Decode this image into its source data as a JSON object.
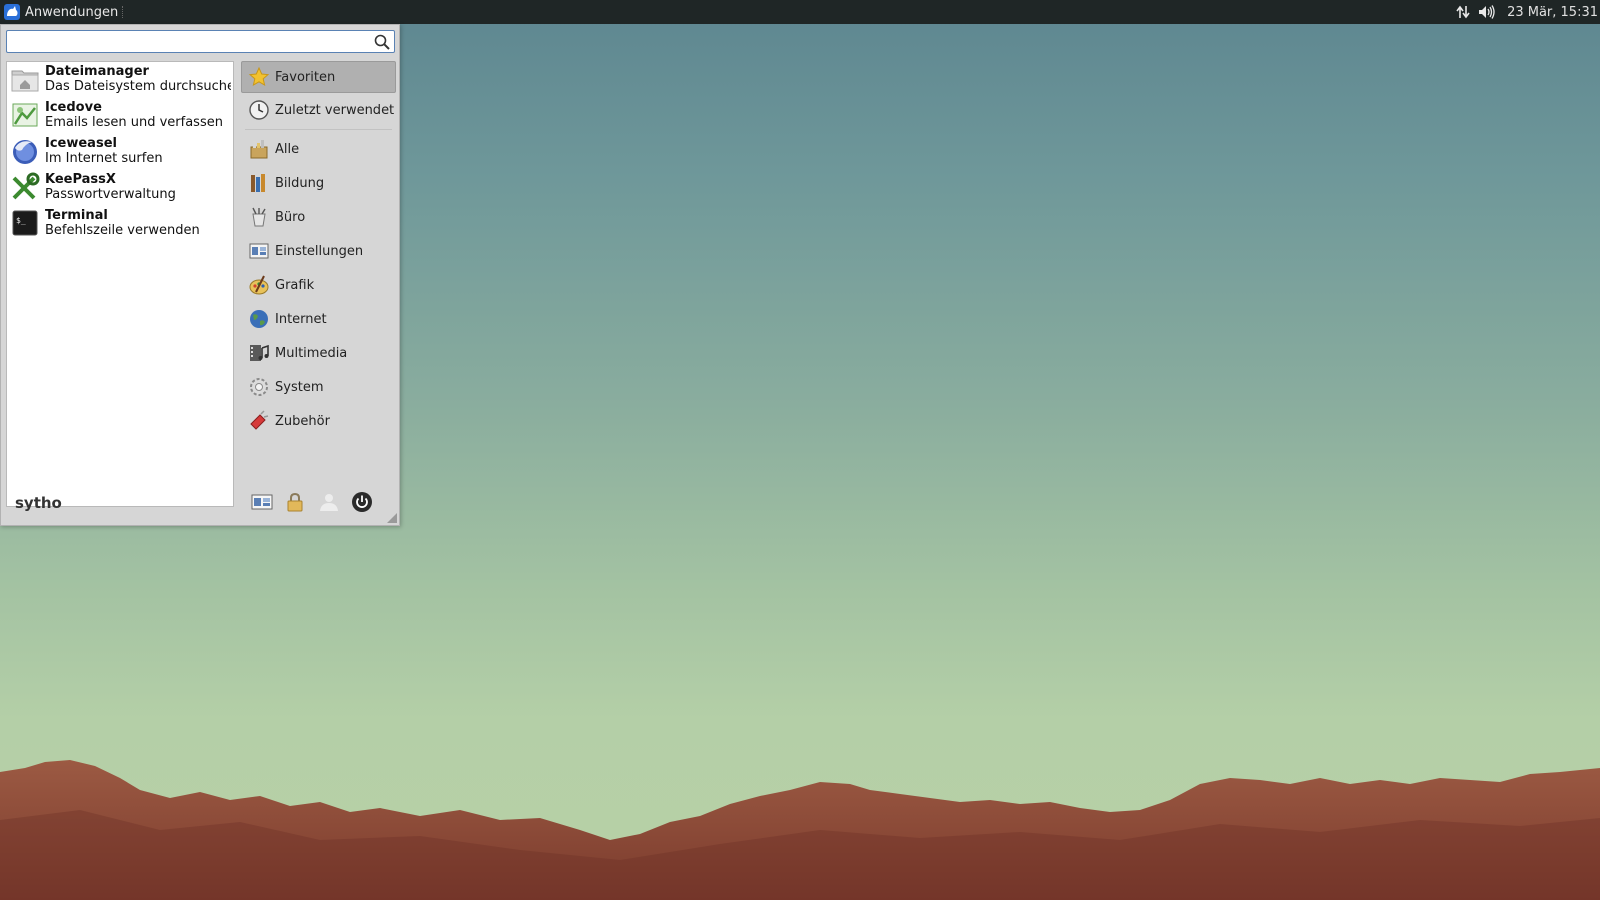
{
  "panel": {
    "apps_label": "Anwendungen",
    "clock": "23 Mär, 15:31"
  },
  "menu": {
    "search": {
      "value": "",
      "placeholder": ""
    },
    "favorites": [
      {
        "name": "Dateimanager",
        "desc": "Das Dateisystem durchsuche...",
        "icon": "folder-home-icon"
      },
      {
        "name": "Icedove",
        "desc": "Emails lesen und verfassen",
        "icon": "icedove-icon"
      },
      {
        "name": "Iceweasel",
        "desc": "Im Internet surfen",
        "icon": "iceweasel-icon"
      },
      {
        "name": "KeePassX",
        "desc": "Passwortverwaltung",
        "icon": "keepassx-icon"
      },
      {
        "name": "Terminal",
        "desc": "Befehlszeile verwenden",
        "icon": "terminal-icon"
      }
    ],
    "categories": [
      {
        "label": "Favoriten",
        "icon": "star-icon",
        "active": true
      },
      {
        "label": "Zuletzt verwendet",
        "icon": "clock-icon"
      },
      {
        "label": "Alle",
        "icon": "all-apps-icon"
      },
      {
        "label": "Bildung",
        "icon": "education-icon"
      },
      {
        "label": "Büro",
        "icon": "office-icon"
      },
      {
        "label": "Einstellungen",
        "icon": "settings-icon"
      },
      {
        "label": "Grafik",
        "icon": "graphics-icon"
      },
      {
        "label": "Internet",
        "icon": "globe-icon"
      },
      {
        "label": "Multimedia",
        "icon": "multimedia-icon"
      },
      {
        "label": "System",
        "icon": "gear-icon"
      },
      {
        "label": "Zubehör",
        "icon": "accessories-icon"
      }
    ],
    "username": "sytho"
  },
  "colors": {
    "panel_bg": "#1f2626",
    "menu_bg": "#d6d6d6",
    "active_category": "#b0b0b0",
    "search_border": "#5a82b4"
  }
}
